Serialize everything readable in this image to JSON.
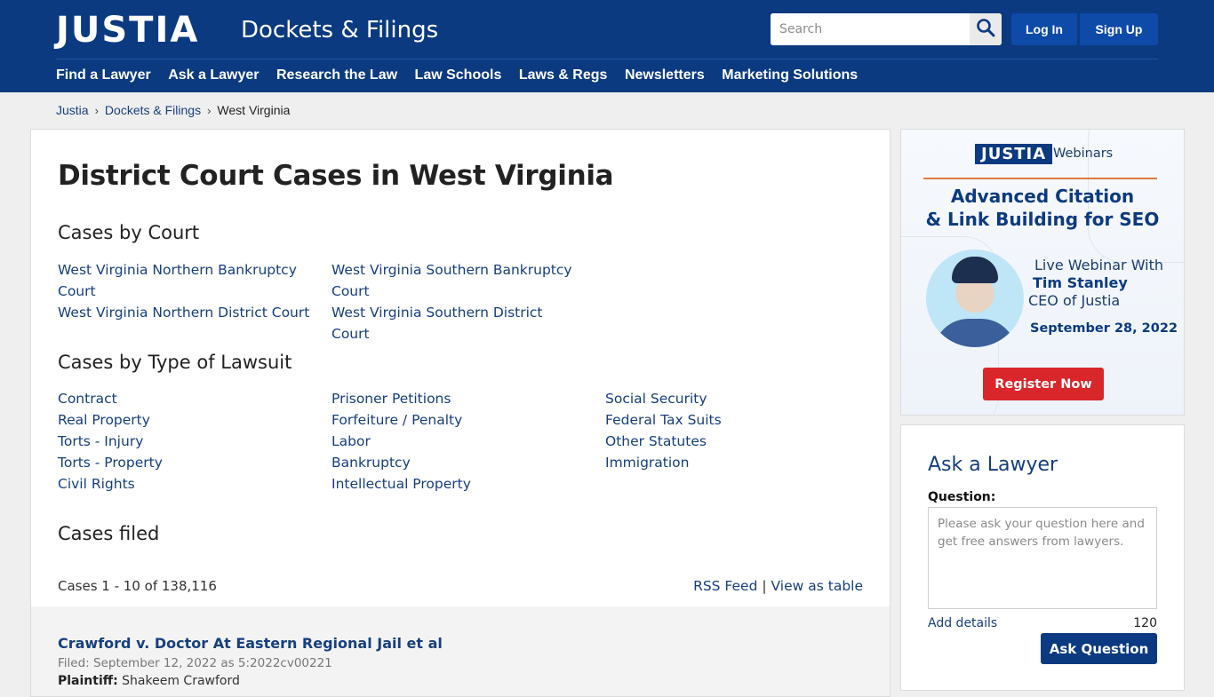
{
  "header": {
    "logo": "JUSTIA",
    "section_title": "Dockets & Filings",
    "search": {
      "placeholder": "Search",
      "value": ""
    },
    "login_label": "Log In",
    "signup_label": "Sign Up",
    "nav": [
      {
        "label": "Find a Lawyer"
      },
      {
        "label": "Ask a Lawyer"
      },
      {
        "label": "Research the Law"
      },
      {
        "label": "Law Schools"
      },
      {
        "label": "Laws & Regs"
      },
      {
        "label": "Newsletters"
      },
      {
        "label": "Marketing Solutions"
      }
    ]
  },
  "breadcrumb": {
    "items": [
      {
        "label": "Justia"
      },
      {
        "label": "Dockets & Filings"
      },
      {
        "label": "West Virginia"
      }
    ],
    "separator": "›"
  },
  "main": {
    "title": "District Court Cases in West Virginia",
    "cases_by_court": {
      "heading": "Cases by Court",
      "columns": [
        [
          "West Virginia Northern Bankruptcy Court",
          "West Virginia Northern District Court"
        ],
        [
          "West Virginia Southern Bankruptcy Court",
          "West Virginia Southern District Court"
        ]
      ]
    },
    "cases_by_type": {
      "heading": "Cases by Type of Lawsuit",
      "columns": [
        [
          "Contract",
          "Real Property",
          "Torts - Injury",
          "Torts - Property",
          "Civil Rights"
        ],
        [
          "Prisoner Petitions",
          "Forfeiture / Penalty",
          "Labor",
          "Bankruptcy",
          "Intellectual Property"
        ],
        [
          "Social Security",
          "Federal Tax Suits",
          "Other Statutes",
          "Immigration"
        ]
      ]
    },
    "cases_filed": {
      "heading": "Cases filed",
      "count_text": "Cases 1 - 10 of 138,116",
      "rss_label": "RSS Feed",
      "divider": "|",
      "table_label": "View as table"
    },
    "cases": [
      {
        "title": "Crawford v. Doctor At Eastern Regional Jail et al",
        "filed": "Filed: September 12, 2022 as 5:2022cv00221",
        "party_label": "Plaintiff:",
        "party_value": "Shakeem Crawford"
      }
    ]
  },
  "ad": {
    "logo": "JUSTIA",
    "logo_sub": "Webinars",
    "title_line1": "Advanced Citation",
    "title_line2": "& Link Building for SEO",
    "live": "Live Webinar With",
    "presenter": "Tim Stanley",
    "role": "CEO of Justia",
    "date": "September 28, 2022",
    "cta": "Register Now",
    "accent_color": "#d9262a"
  },
  "ask_lawyer": {
    "heading": "Ask a Lawyer",
    "question_label": "Question:",
    "placeholder": "Please ask your question here and get free answers from lawyers.",
    "value": "",
    "add_details": "Add details",
    "char_count": "120",
    "submit_label": "Ask Question"
  },
  "colors": {
    "brand_blue": "#0b3a80",
    "link": "#173f7d",
    "button_blue": "#0e4aa8"
  }
}
